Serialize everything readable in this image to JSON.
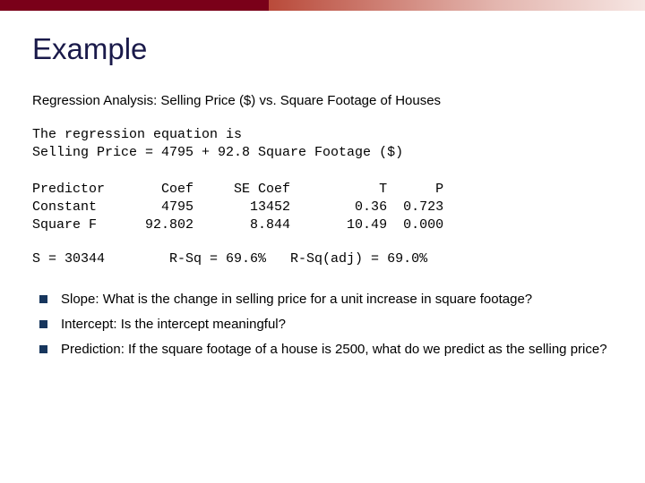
{
  "title": "Example",
  "subhead": "Regression Analysis: Selling Price ($) vs. Square Footage of Houses",
  "equation": {
    "line1": "The regression equation is",
    "line2": "Selling Price = 4795 + 92.8 Square Footage ($)"
  },
  "table": {
    "header": "Predictor       Coef     SE Coef           T      P",
    "row1": "Constant        4795       13452        0.36  0.723",
    "row2": "Square F      92.802       8.844       10.49  0.000"
  },
  "stats_line": "S = 30344        R-Sq = 69.6%   R-Sq(adj) = 69.0%",
  "bullets": [
    "Slope: What is the change in selling price for a unit increase in square footage?",
    "Intercept: Is the intercept meaningful?",
    "Prediction: If the square footage of a house is 2500, what do we predict as the selling price?"
  ]
}
